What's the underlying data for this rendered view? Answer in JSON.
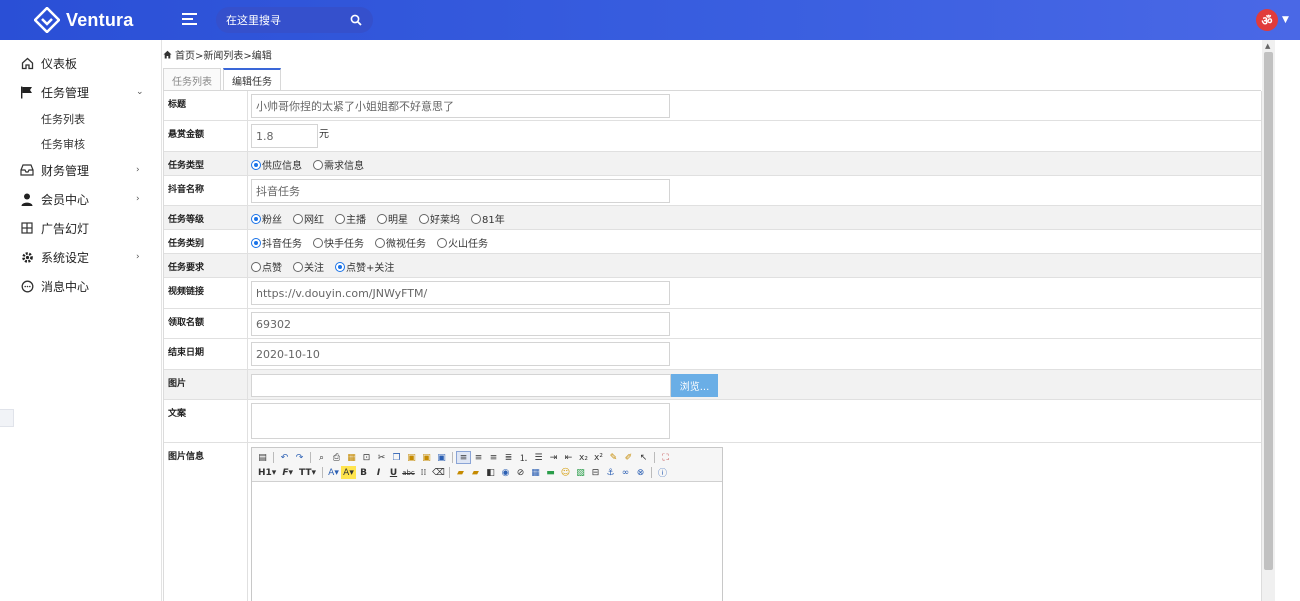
{
  "app": {
    "name": "Ventura"
  },
  "header": {
    "search_placeholder": "在这里搜寻",
    "avatar_glyph": "ॐ"
  },
  "sidebar": {
    "items": [
      {
        "label": "仪表板",
        "icon": "home-icon"
      },
      {
        "label": "任务管理",
        "icon": "flag-icon",
        "expanded": true,
        "children": [
          {
            "label": "任务列表"
          },
          {
            "label": "任务审核"
          }
        ]
      },
      {
        "label": "财务管理",
        "icon": "inbox-icon"
      },
      {
        "label": "会员中心",
        "icon": "user-icon"
      },
      {
        "label": "广告幻灯",
        "icon": "grid-icon"
      },
      {
        "label": "系统设定",
        "icon": "gear-icon"
      },
      {
        "label": "消息中心",
        "icon": "message-icon"
      }
    ]
  },
  "breadcrumb": {
    "text": "首页>新闻列表>编辑"
  },
  "tabs": [
    {
      "label": "任务列表",
      "active": false
    },
    {
      "label": "编辑任务",
      "active": true
    }
  ],
  "form": {
    "title": {
      "label": "标题",
      "value": "小帅哥你捏的太紧了小姐姐都不好意思了"
    },
    "reward": {
      "label": "悬赏金额",
      "value": "1.8",
      "unit": "元"
    },
    "task_type": {
      "label": "任务类型",
      "options": [
        "供应信息",
        "需求信息"
      ],
      "selected": 0
    },
    "douyin_name": {
      "label": "抖音名称",
      "value": "抖音任务"
    },
    "level": {
      "label": "任务等级",
      "options": [
        "粉丝",
        "网红",
        "主播",
        "明星",
        "好莱坞",
        "81年"
      ],
      "selected": 0
    },
    "category": {
      "label": "任务类别",
      "options": [
        "抖音任务",
        "快手任务",
        "微视任务",
        "火山任务"
      ],
      "selected": 0
    },
    "requirement": {
      "label": "任务要求",
      "options": [
        "点赞",
        "关注",
        "点赞+关注"
      ],
      "selected": 2
    },
    "video_link": {
      "label": "视频链接",
      "value": "https://v.douyin.com/JNWyFTM/"
    },
    "quota": {
      "label": "领取名额",
      "value": "69302"
    },
    "end_date": {
      "label": "结束日期",
      "value": "2020-10-10"
    },
    "image": {
      "label": "图片",
      "browse_label": "浏览..."
    },
    "copy": {
      "label": "文案",
      "value": ""
    },
    "image_info": {
      "label": "图片信息"
    }
  },
  "colors": {
    "topbar": "#2a4fd6",
    "accent": "#1a73e8",
    "browse": "#6aaee6"
  }
}
